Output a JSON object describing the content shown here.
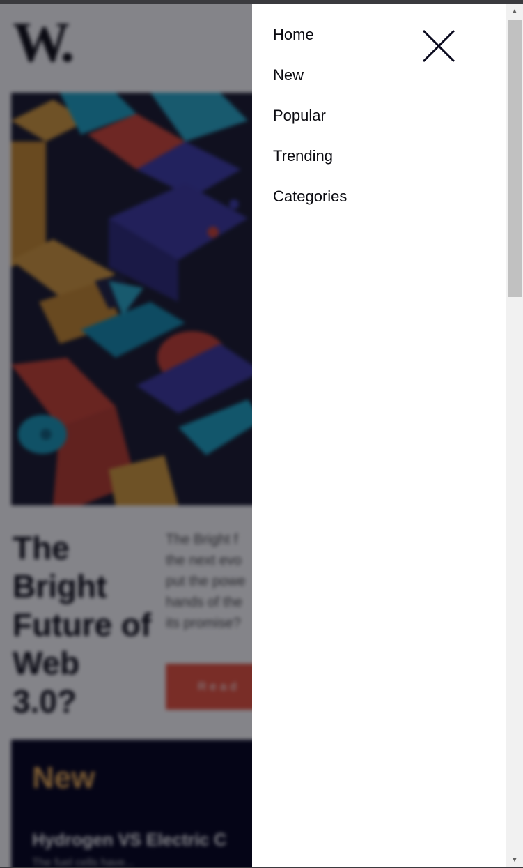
{
  "site": {
    "logo_text": "W."
  },
  "hero": {
    "title": "The Bright Future of Web 3.0?",
    "blurb_lines": [
      "The Bright f",
      "the next evo",
      "put the powe",
      "hands of the",
      "its promise?"
    ],
    "read_more_label": "Read"
  },
  "new_section": {
    "heading": "New",
    "item_title": "Hydrogen VS Electric C",
    "item_text": "The fuel cells have..."
  },
  "drawer": {
    "menu_items": [
      {
        "label": "Home"
      },
      {
        "label": "New"
      },
      {
        "label": "Popular"
      },
      {
        "label": "Trending"
      },
      {
        "label": "Categories"
      }
    ],
    "close_icon": "close-icon"
  },
  "colors": {
    "accent_orange": "#e8503a",
    "accent_yellow": "#e9ab53",
    "dark_navy": "#00001a"
  },
  "scrollbar": {
    "up_arrow": "▲",
    "down_arrow": "▼"
  }
}
